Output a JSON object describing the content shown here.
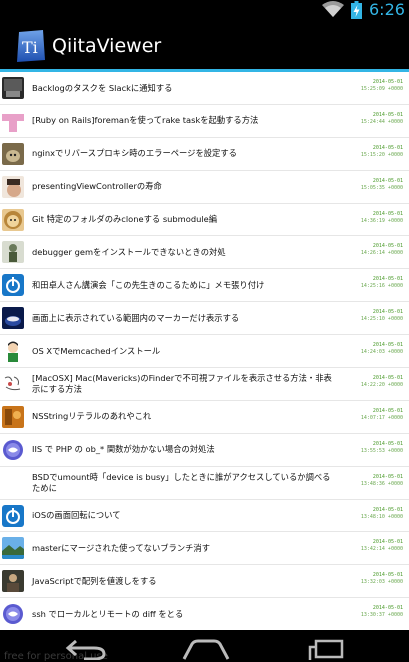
{
  "status_bar": {
    "time": "6:26"
  },
  "action_bar": {
    "app_title": "QiitaViewer",
    "app_icon_text": "Ti"
  },
  "items": [
    {
      "title": "Backlogのタスクを Slackに通知する",
      "date": "2014-05-01",
      "time": "15:25:09 +0000",
      "avatar": "dark-photo"
    },
    {
      "title": "[Ruby on Rails]foremanを使ってrake taskを起動する方法",
      "date": "2014-05-01",
      "time": "15:24:44 +0000",
      "avatar": "pink-cross"
    },
    {
      "title": "nginxでリバースプロキシ時のエラーページを設定する",
      "date": "2014-05-01",
      "time": "15:15:20 +0000",
      "avatar": "cat-photo"
    },
    {
      "title": "presentingViewControllerの寿命",
      "date": "2014-05-01",
      "time": "15:05:35 +0000",
      "avatar": "face-photo"
    },
    {
      "title": "Git 特定のフォルダのみcloneする submodule編",
      "date": "2014-05-01",
      "time": "14:36:19 +0000",
      "avatar": "lion-photo"
    },
    {
      "title": "debugger gemをインストールできないときの対処",
      "date": "2014-05-01",
      "time": "14:26:14 +0000",
      "avatar": "figure-photo"
    },
    {
      "title": "和田卓人さん講演会「この先生きのこるために」メモ張り付け",
      "date": "2014-05-01",
      "time": "14:25:16 +0000",
      "avatar": "blue-power"
    },
    {
      "title": "画面上に表示されている範囲内のマーカーだけ表示する",
      "date": "2014-05-01",
      "time": "14:25:10 +0000",
      "avatar": "blue-cup"
    },
    {
      "title": "OS XでMemcachedインストール",
      "date": "2014-05-01",
      "time": "14:24:03 +0000",
      "avatar": "cartoon-boy"
    },
    {
      "title": "[MacOSX] Mac(Mavericks)のFinderで不可視ファイルを表示させる方法・非表示にする方法",
      "date": "2014-05-01",
      "time": "14:22:20 +0000",
      "avatar": "sketch"
    },
    {
      "title": "NSStringリテラルのあれやこれ",
      "date": "2014-05-01",
      "time": "14:07:17 +0000",
      "avatar": "orange-photo"
    },
    {
      "title": "IIS で PHP の ob_* 関数が効かない場合の対処法",
      "date": "2014-05-01",
      "time": "13:55:53 +0000",
      "avatar": "php-logo"
    },
    {
      "title": "BSDでumount時「device is busy」したときに誰がアクセスしているか調べるために",
      "date": "2014-05-01",
      "time": "13:48:36 +0000",
      "avatar": "none"
    },
    {
      "title": "iOSの画面回転について",
      "date": "2014-05-01",
      "time": "13:48:10 +0000",
      "avatar": "blue-power"
    },
    {
      "title": "masterにマージされた使ってないブランチ消す",
      "date": "2014-05-01",
      "time": "13:42:14 +0000",
      "avatar": "landscape"
    },
    {
      "title": "JavaScriptで配列を値渡しをする",
      "date": "2014-05-01",
      "time": "13:32:03 +0000",
      "avatar": "person-photo"
    },
    {
      "title": "ssh でローカルとリモートの diff をとる",
      "date": "2014-05-01",
      "time": "13:30:37 +0000",
      "avatar": "php-logo"
    }
  ],
  "nav_bar": {
    "watermark": "free for personal use"
  }
}
